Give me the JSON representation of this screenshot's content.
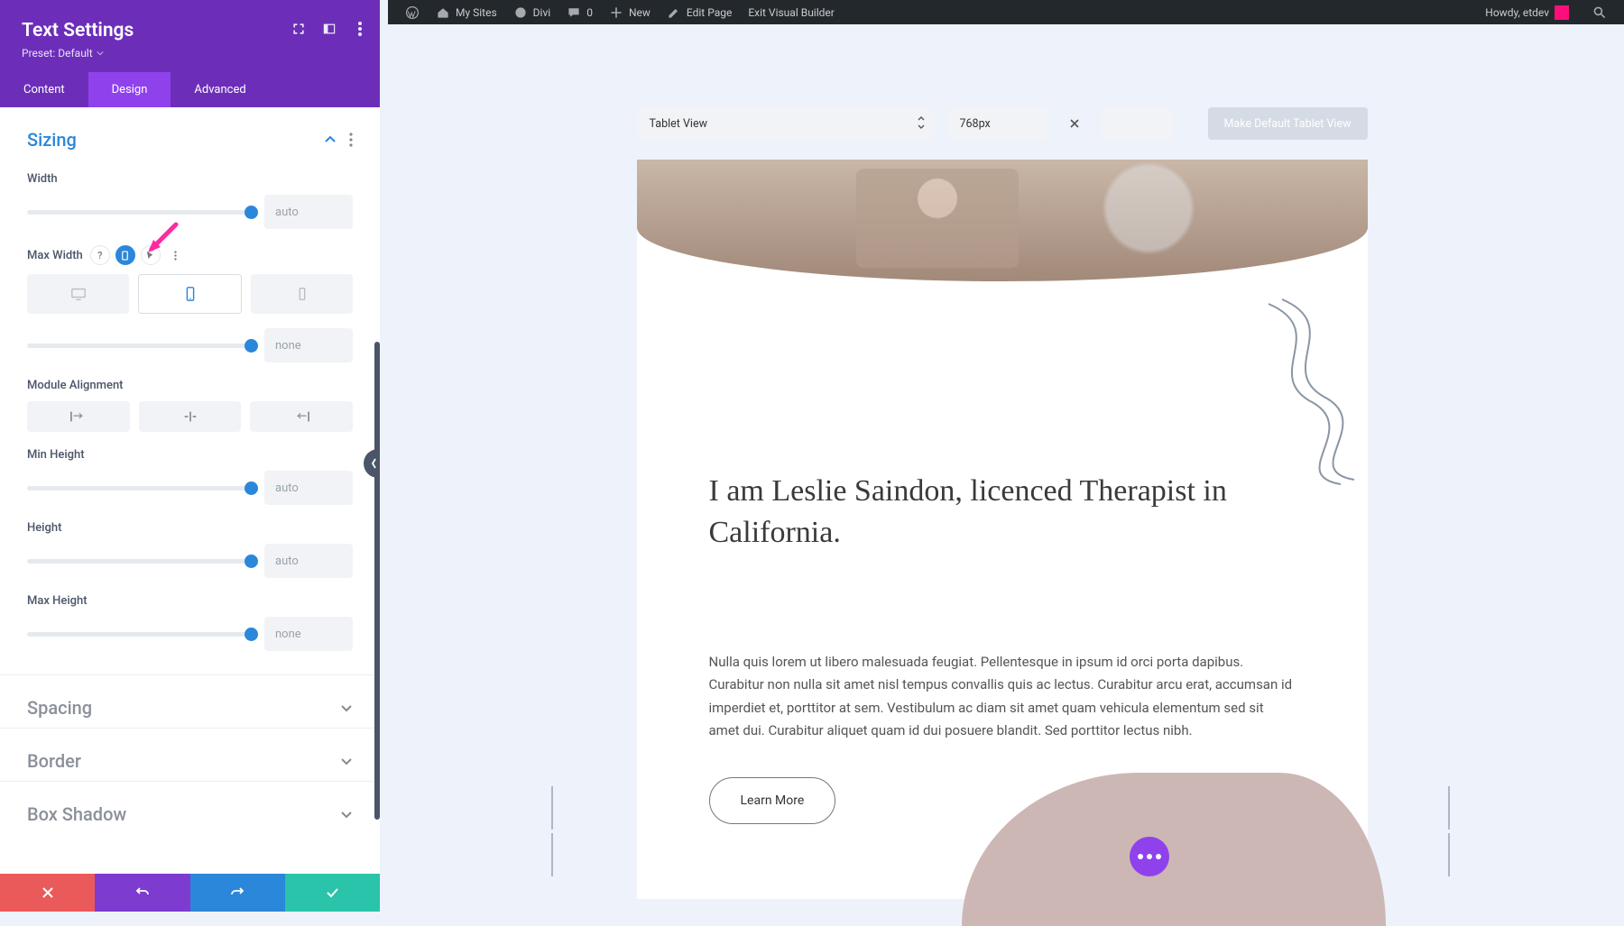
{
  "adminbar": {
    "mysites": "My Sites",
    "divi": "Divi",
    "comments": "0",
    "new": "New",
    "editpage": "Edit Page",
    "exitvb": "Exit Visual Builder",
    "howdy": "Howdy, etdev"
  },
  "panel": {
    "title": "Text Settings",
    "preset": "Preset: Default",
    "tabs": {
      "content": "Content",
      "design": "Design",
      "advanced": "Advanced"
    }
  },
  "sizing": {
    "title": "Sizing",
    "width_label": "Width",
    "width_value": "auto",
    "maxwidth_label": "Max Width",
    "maxwidth_value": "none",
    "module_align_label": "Module Alignment",
    "minheight_label": "Min Height",
    "minheight_value": "auto",
    "height_label": "Height",
    "height_value": "auto",
    "maxheight_label": "Max Height",
    "maxheight_value": "none"
  },
  "sections": {
    "spacing": "Spacing",
    "border": "Border",
    "boxshadow": "Box Shadow"
  },
  "canvas": {
    "view_select": "Tablet View",
    "width_px": "768px",
    "make_default": "Make Default Tablet View"
  },
  "page": {
    "title": "I am Leslie Saindon, licenced Therapist in California.",
    "body": "Nulla quis lorem ut libero malesuada feugiat. Pellentesque in ipsum id orci porta dapibus. Curabitur non nulla sit amet nisl tempus convallis quis ac lectus. Curabitur arcu erat, accumsan id imperdiet et, porttitor at sem. Vestibulum ac diam sit amet quam vehicula elementum sed sit amet dui. Curabitur aliquet quam id dui posuere blandit. Sed porttitor lectus nibh.",
    "learn_more": "Learn More"
  }
}
